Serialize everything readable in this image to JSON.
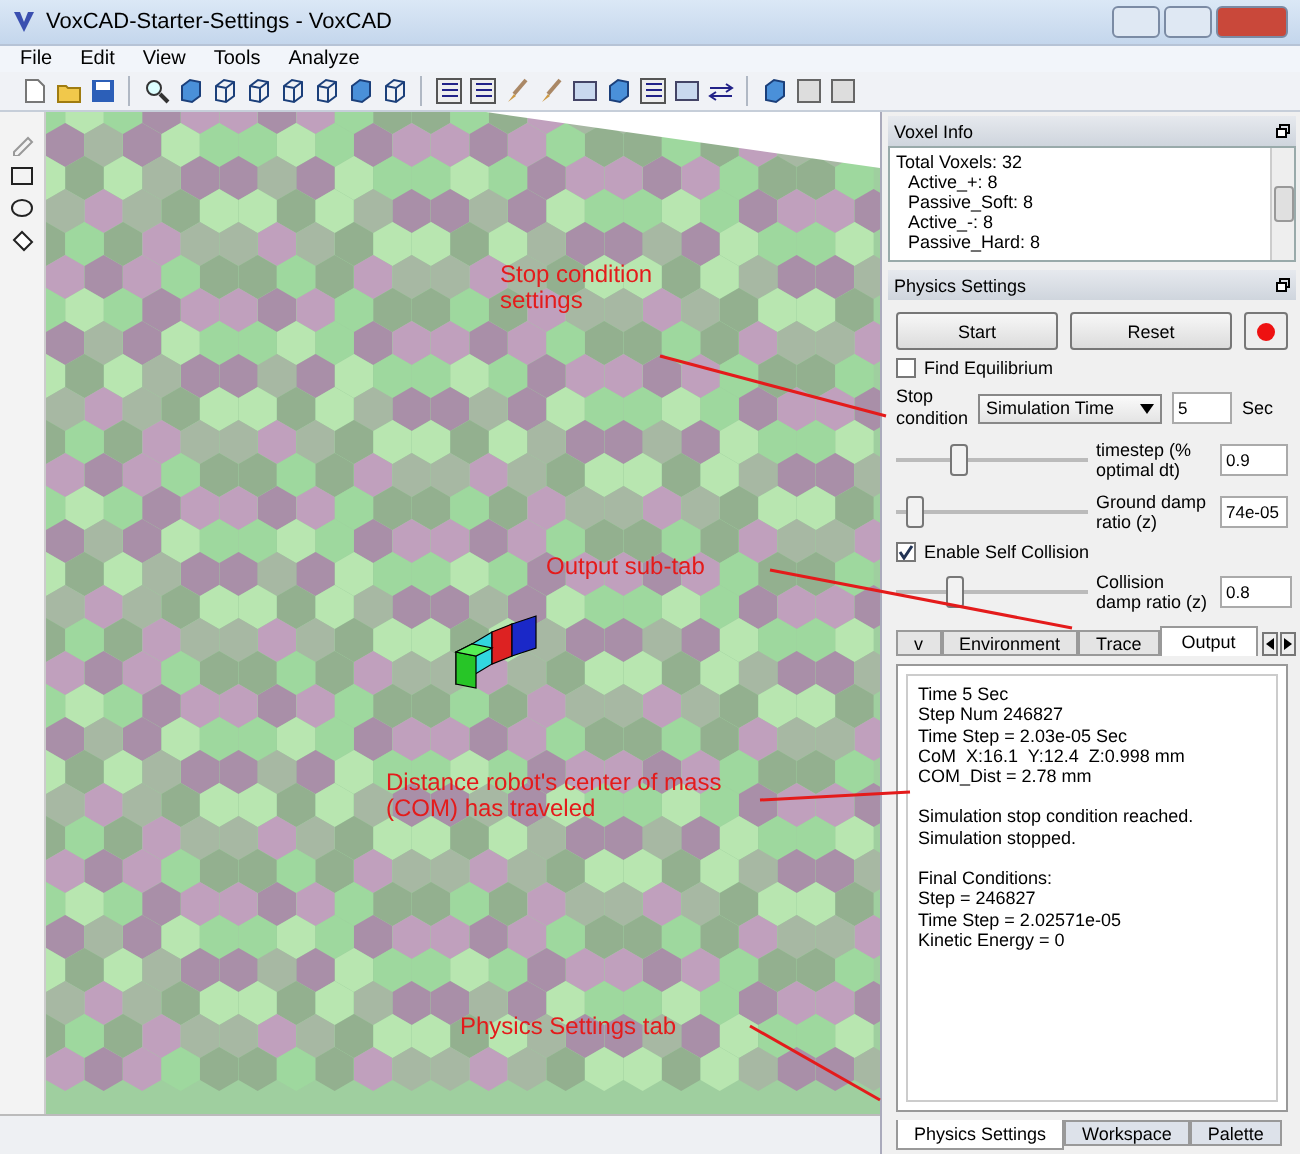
{
  "window": {
    "title": "VoxCAD-Starter-Settings - VoxCAD"
  },
  "menu": [
    "File",
    "Edit",
    "View",
    "Tools",
    "Analyze"
  ],
  "voxel_info": {
    "title": "Voxel Info",
    "lines": [
      "Total Voxels: 32",
      "Active_+: 8",
      "Passive_Soft: 8",
      "Active_-: 8",
      "Passive_Hard: 8"
    ]
  },
  "physics_settings": {
    "title": "Physics Settings",
    "start_button": "Start",
    "reset_button": "Reset",
    "find_equilibrium": {
      "label": "Find Equilibrium",
      "checked": false
    },
    "stop_condition": {
      "label": "Stop condition",
      "select": "Simulation Time",
      "value": "5",
      "unit": "Sec"
    },
    "sliders": [
      {
        "label": "timestep (% optimal dt)",
        "level": 0.3,
        "value": "0.9"
      },
      {
        "label": "Ground damp ratio (z)",
        "level": 0.05,
        "value": "74e-05"
      }
    ],
    "self_collision": {
      "label": "Enable Self Collision",
      "checked": true
    },
    "collision_slider": {
      "label": "Collision damp ratio (z)",
      "level": 0.28,
      "value": "0.8"
    },
    "sub_tabs": [
      {
        "label": "v",
        "selected": false
      },
      {
        "label": "Environment",
        "selected": false
      },
      {
        "label": "Trace",
        "selected": false
      },
      {
        "label": "Output",
        "selected": true
      }
    ],
    "output_groups": [
      [
        "Time 5 Sec",
        "Step Num 246827",
        "Time Step = 2.03e-05 Sec",
        "CoM  X:16.1  Y:12.4  Z:0.998 mm",
        "COM_Dist = 2.78 mm"
      ],
      [
        "Simulation stop condition reached.",
        "Simulation stopped."
      ],
      [
        "Final Conditions:",
        "Step = 246827",
        "Time Step = 2.02571e-05",
        "Kinetic Energy = 0"
      ]
    ]
  },
  "dock_tabs": [
    {
      "label": "Physics Settings",
      "selected": true
    },
    {
      "label": "Workspace",
      "selected": false
    },
    {
      "label": "Palette",
      "selected": false
    }
  ],
  "annotations": [
    {
      "text": "Stop condition settings"
    },
    {
      "text": "Output sub-tab"
    },
    {
      "text": "Distance robot's center of mass (COM) has traveled"
    },
    {
      "text": "Physics Settings tab"
    }
  ]
}
